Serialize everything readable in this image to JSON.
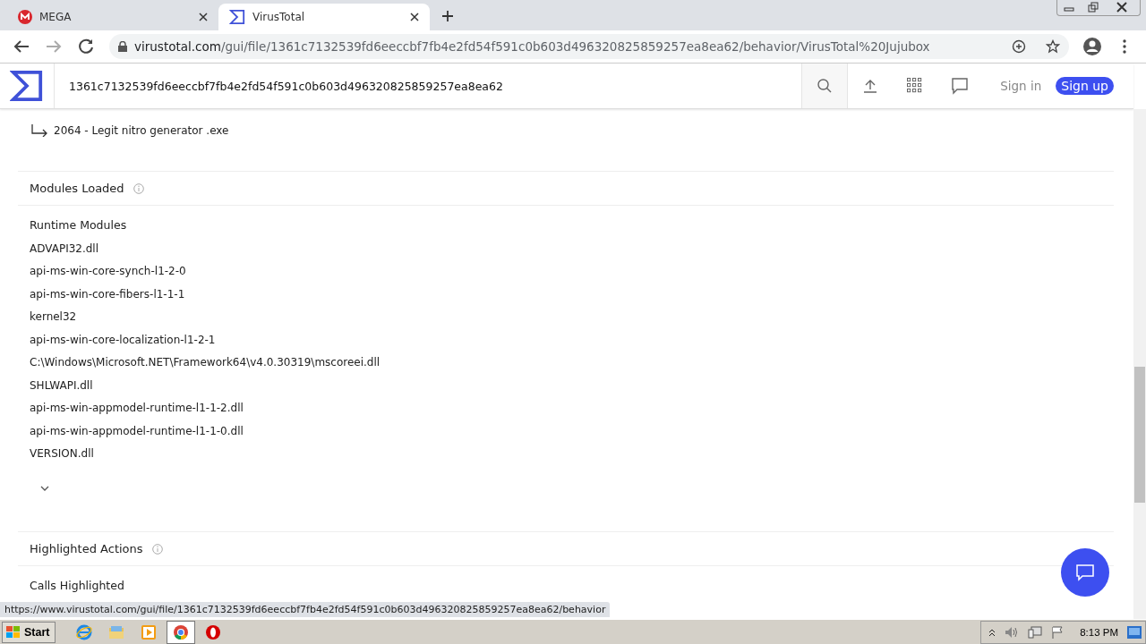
{
  "browser": {
    "tabs": [
      {
        "title": "MEGA",
        "kind": "mega",
        "selected": false
      },
      {
        "title": "VirusTotal",
        "kind": "vt",
        "selected": true
      }
    ],
    "address": {
      "host": "virustotal.com",
      "path": "/gui/file/1361c7132539fd6eeccbf7fb4e2fd54f591c0b603d496320825859257ea8ea62/behavior/VirusTotal%20Jujubox"
    }
  },
  "header": {
    "search_value": "1361c7132539fd6eeccbf7fb4e2fd54f591c0b603d496320825859257ea8ea62",
    "sign_in": "Sign in",
    "sign_up": "Sign up"
  },
  "content": {
    "process": "2064 - Legit nitro generator .exe",
    "sections": [
      {
        "title": "Modules Loaded",
        "subtitle": "Runtime Modules",
        "items": [
          "ADVAPI32.dll",
          "api-ms-win-core-synch-l1-2-0",
          "api-ms-win-core-fibers-l1-1-1",
          "kernel32",
          "api-ms-win-core-localization-l1-2-1",
          "C:\\Windows\\Microsoft.NET\\Framework64\\v4.0.30319\\mscoreei.dll",
          "SHLWAPI.dll",
          "api-ms-win-appmodel-runtime-l1-1-2.dll",
          "api-ms-win-appmodel-runtime-l1-1-0.dll",
          "VERSION.dll"
        ],
        "expandable": true
      },
      {
        "title": "Highlighted Actions",
        "subtitle": "Calls Highlighted",
        "expandable": false
      }
    ]
  },
  "status_url": "https://www.virustotal.com/gui/file/1361c7132539fd6eeccbf7fb4e2fd54f591c0b603d496320825859257ea8ea62/behavior",
  "taskbar": {
    "start": "Start",
    "clock": "8:13 PM",
    "apps": [
      {
        "kind": "ie",
        "selected": false
      },
      {
        "kind": "explorer",
        "selected": false
      },
      {
        "kind": "media",
        "selected": false
      },
      {
        "kind": "chrome",
        "selected": true
      },
      {
        "kind": "opera",
        "selected": false
      }
    ]
  }
}
